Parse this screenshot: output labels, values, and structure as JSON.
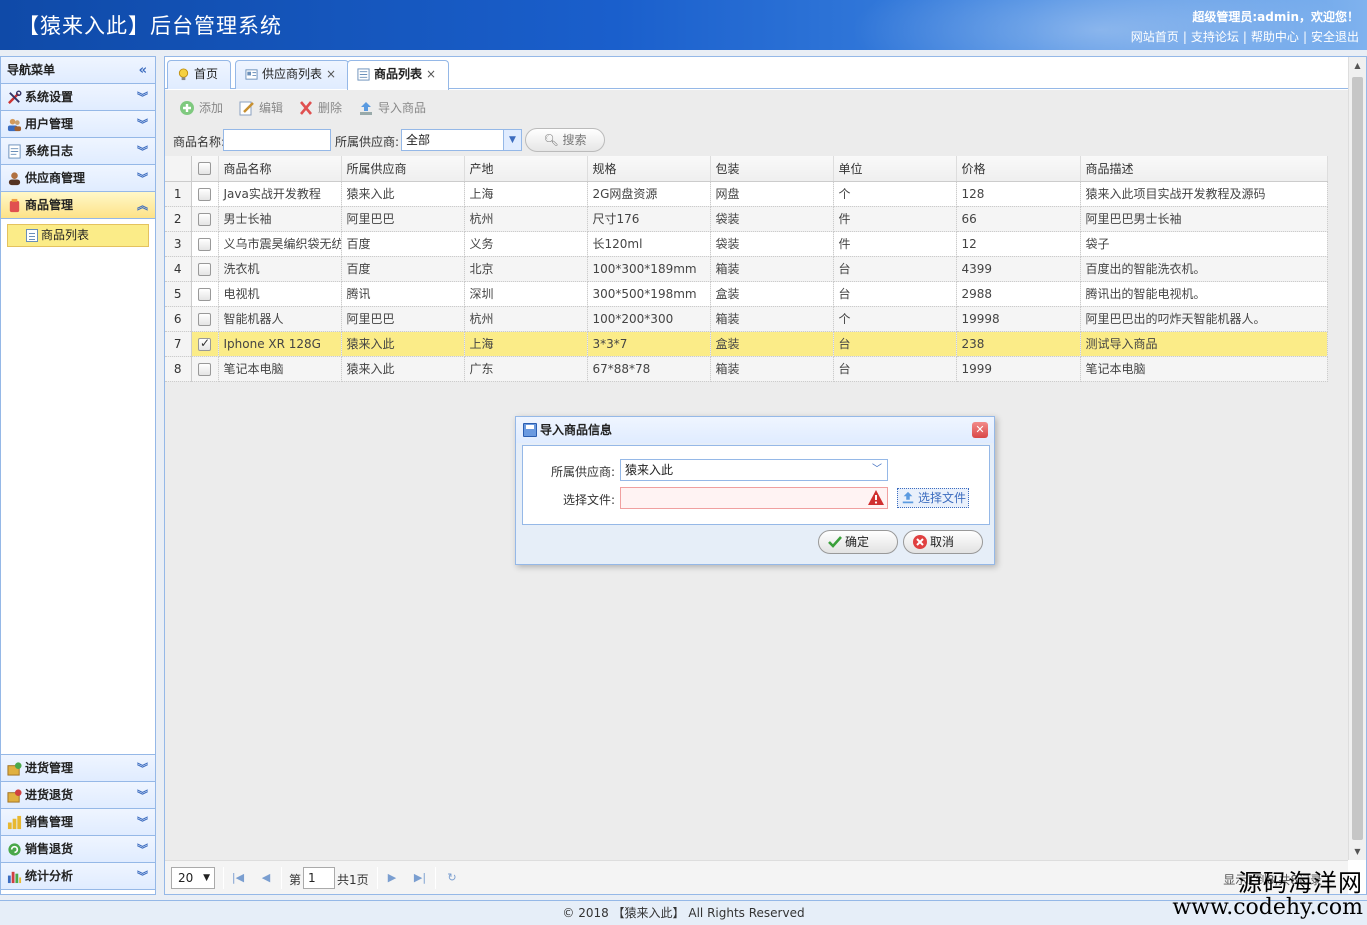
{
  "header": {
    "title": "【猿来入此】后台管理系统",
    "welcome": "超级管理员:admin，欢迎您！",
    "links": [
      "网站首页",
      "支持论坛",
      "帮助中心",
      "安全退出"
    ]
  },
  "sidebar": {
    "title": "导航菜单",
    "items_top": [
      {
        "label": "系统设置",
        "icon": "tools-icon"
      },
      {
        "label": "用户管理",
        "icon": "users-icon"
      },
      {
        "label": "系统日志",
        "icon": "log-icon"
      },
      {
        "label": "供应商管理",
        "icon": "supplier-icon"
      },
      {
        "label": "商品管理",
        "icon": "goods-icon",
        "active": true
      }
    ],
    "sub_items": [
      {
        "label": "商品列表",
        "icon": "list-icon"
      }
    ],
    "items_bottom": [
      {
        "label": "进货管理",
        "icon": "purchase-icon"
      },
      {
        "label": "进货退货",
        "icon": "purchase-return-icon"
      },
      {
        "label": "销售管理",
        "icon": "sales-icon"
      },
      {
        "label": "销售退货",
        "icon": "sales-return-icon"
      },
      {
        "label": "统计分析",
        "icon": "chart-icon"
      }
    ]
  },
  "tabs": [
    {
      "label": "首页",
      "icon": "bulb-icon",
      "closable": false
    },
    {
      "label": "供应商列表",
      "icon": "card-icon",
      "closable": true
    },
    {
      "label": "商品列表",
      "icon": "list-icon",
      "closable": true,
      "active": true
    }
  ],
  "toolbar": {
    "add_label": "添加",
    "edit_label": "编辑",
    "delete_label": "删除",
    "import_label": "导入商品"
  },
  "search": {
    "name_label": "商品名称:",
    "name_value": "",
    "supplier_label": "所属供应商:",
    "supplier_value": "全部",
    "search_label": "搜索"
  },
  "grid": {
    "headers": [
      "商品名称",
      "所属供应商",
      "产地",
      "规格",
      "包装",
      "单位",
      "价格",
      "商品描述"
    ],
    "rows": [
      {
        "no": "1",
        "checked": false,
        "cells": [
          "Java实战开发教程",
          "猿来入此",
          "上海",
          "2G网盘资源",
          "网盘",
          "个",
          "128",
          "猿来入此项目实战开发教程及源码"
        ]
      },
      {
        "no": "2",
        "checked": false,
        "cells": [
          "男士长袖",
          "阿里巴巴",
          "杭州",
          "尺寸176",
          "袋装",
          "件",
          "66",
          "阿里巴巴男士长袖"
        ]
      },
      {
        "no": "3",
        "checked": false,
        "cells": [
          "义乌市震昊编织袋无纺",
          "百度",
          "义务",
          "长120ml",
          "袋装",
          "件",
          "12",
          "袋子"
        ]
      },
      {
        "no": "4",
        "checked": false,
        "cells": [
          "洗衣机",
          "百度",
          "北京",
          "100*300*189mm",
          "箱装",
          "台",
          "4399",
          "百度出的智能洗衣机。"
        ]
      },
      {
        "no": "5",
        "checked": false,
        "cells": [
          "电视机",
          "腾讯",
          "深圳",
          "300*500*198mm",
          "盒装",
          "台",
          "2988",
          "腾讯出的智能电视机。"
        ]
      },
      {
        "no": "6",
        "checked": false,
        "cells": [
          "智能机器人",
          "阿里巴巴",
          "杭州",
          "100*200*300",
          "箱装",
          "个",
          "19998",
          "阿里巴巴出的叼炸天智能机器人。"
        ]
      },
      {
        "no": "7",
        "checked": true,
        "cells": [
          "Iphone XR 128G",
          "猿来入此",
          "上海",
          "3*3*7",
          "盒装",
          "台",
          "238",
          "测试导入商品"
        ]
      },
      {
        "no": "8",
        "checked": false,
        "cells": [
          "笔记本电脑",
          "猿来入此",
          "广东",
          "67*88*78",
          "箱装",
          "台",
          "1999",
          "笔记本电脑"
        ]
      }
    ]
  },
  "pager": {
    "page_size": "20",
    "page_prefix": "第",
    "page_value": "1",
    "page_suffix": "共1页",
    "info": "显示1到8,共8记录"
  },
  "dialog": {
    "title": "导入商品信息",
    "supplier_label": "所属供应商:",
    "supplier_value": "猿来入此",
    "file_label": "选择文件:",
    "choose_label": "选择文件",
    "ok_label": "确定",
    "cancel_label": "取消"
  },
  "footer": {
    "text": "© 2018 【猿来入此】 All Rights Reserved"
  },
  "watermark": {
    "line1": "源码海洋网",
    "line2": "www.codehy.com"
  }
}
